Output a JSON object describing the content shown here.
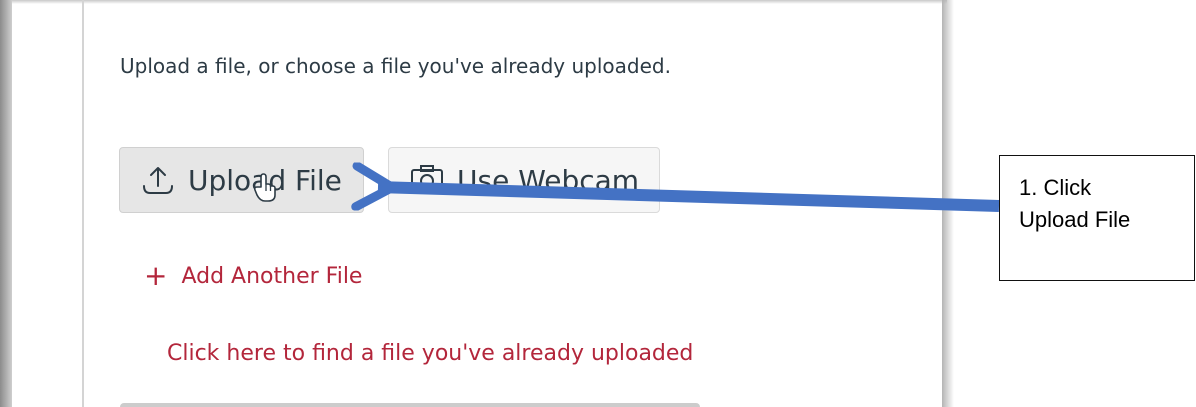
{
  "screenshot": {
    "instruction": "Upload a file, or choose a file you've already uploaded.",
    "upload_button": {
      "label": "Upload File",
      "icon": "upload-icon"
    },
    "webcam_button": {
      "label": "Use Webcam",
      "icon": "camera-icon"
    },
    "add_another": {
      "label": "Add Another File",
      "icon": "plus-icon"
    },
    "find_uploaded": {
      "label": "Click here to find a file you've already uploaded"
    },
    "link_color": "#b3263b",
    "text_color": "#2d3b45"
  },
  "annotation": {
    "callout_line1": "1. Click",
    "callout_line2": "Upload File",
    "arrow_color": "#4472c4"
  }
}
